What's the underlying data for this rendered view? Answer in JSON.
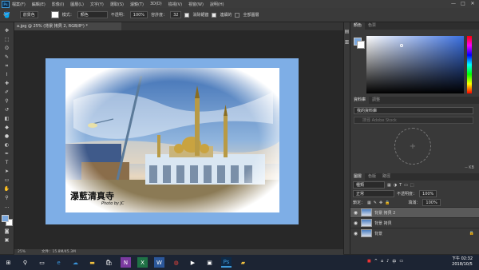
{
  "menubar": {
    "logo": "Ps",
    "items": [
      "檔案(F)",
      "編輯(E)",
      "影像(I)",
      "圖層(L)",
      "文字(Y)",
      "選取(S)",
      "濾鏡(T)",
      "3D(D)",
      "檢視(V)",
      "視窗(W)",
      "說明(H)"
    ],
    "window_buttons": [
      "—",
      "□",
      "✕"
    ]
  },
  "options": {
    "brush_preset": "前景色",
    "mode_label": "模式：",
    "mode_value": "顏色",
    "opacity_label": "不透明：",
    "opacity_value": "100%",
    "tolerance_label": "容許度：",
    "tolerance_value": "32",
    "antialias_label": "消除鋸齒",
    "contiguous_label": "連續的",
    "all_layers_label": "全部圖層"
  },
  "document": {
    "tab_title": "a.jpg @ 25% (背景 拷貝 2, RGB/8*) *",
    "caption_title": "瀑藍清真寺",
    "caption_credit": "Photo by JC",
    "status_zoom": "25%",
    "status_doc": "文件：15.8M/45.3M"
  },
  "panels": {
    "color": {
      "tabs": [
        "顏色",
        "色票"
      ]
    },
    "library": {
      "tabs": [
        "資料庫",
        "調整"
      ],
      "dropdown": "我的資料庫",
      "search_placeholder": "搜尋 Adobe Stock",
      "size_label": "-- KB"
    },
    "layers": {
      "tabs": [
        "圖層",
        "色版",
        "路徑"
      ],
      "filter_label": "種類",
      "blend_mode": "正常",
      "opacity_label": "不透明度：",
      "opacity_value": "100%",
      "lock_label": "鎖定：",
      "fill_label": "填滿：",
      "fill_value": "100%",
      "items": [
        {
          "name": "背景 拷貝 2",
          "selected": true
        },
        {
          "name": "背景 拷貝",
          "selected": false
        },
        {
          "name": "背景",
          "selected": false
        }
      ]
    }
  },
  "taskbar": {
    "time": "下午 02:32",
    "date": "2018/10/5",
    "ime": "中"
  },
  "colors": {
    "canvas_bg": "#7eaee6",
    "accent": "#3d9ad9"
  }
}
